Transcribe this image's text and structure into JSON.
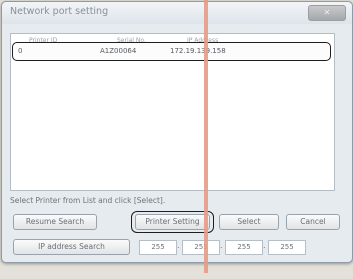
{
  "window": {
    "title": "Network port setting",
    "close_icon": "close-icon"
  },
  "list": {
    "columns": [
      "Printer ID",
      "Serial No.",
      "IP Address"
    ],
    "rows": [
      [
        "0",
        "A1Z00064",
        "172.19.139.158"
      ]
    ]
  },
  "hint": "Select Printer from List and click [Select].",
  "buttons": {
    "resume_search": "Resume Search",
    "printer_setting": "Printer Setting",
    "select": "Select",
    "cancel": "Cancel",
    "ip_search": "IP address Search"
  },
  "ip_fields": [
    "255",
    "255",
    "255",
    "255"
  ],
  "colors": {
    "highlight": "#1e1e1e",
    "guide_line": "#e59b86"
  }
}
